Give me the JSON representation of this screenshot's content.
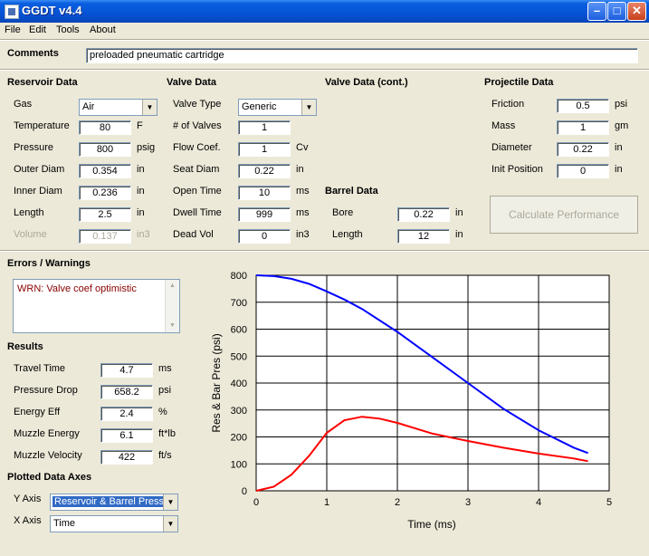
{
  "window": {
    "title": "GGDT v4.4"
  },
  "menu": [
    "File",
    "Edit",
    "Tools",
    "About"
  ],
  "comments": {
    "label": "Comments",
    "value": "preloaded pneumatic cartridge"
  },
  "reservoir": {
    "heading": "Reservoir Data",
    "gas_label": "Gas",
    "gas_value": "Air",
    "rows": [
      {
        "label": "Temperature",
        "value": "80",
        "unit": "F"
      },
      {
        "label": "Pressure",
        "value": "800",
        "unit": "psig"
      },
      {
        "label": "Outer Diam",
        "value": "0.354",
        "unit": "in"
      },
      {
        "label": "Inner Diam",
        "value": "0.236",
        "unit": "in"
      },
      {
        "label": "Length",
        "value": "2.5",
        "unit": "in"
      },
      {
        "label": "Volume",
        "value": "0.137",
        "unit": "in3"
      }
    ]
  },
  "valve": {
    "heading": "Valve Data",
    "type_label": "Valve Type",
    "type_value": "Generic",
    "rows": [
      {
        "label": "# of Valves",
        "value": "1",
        "unit": ""
      },
      {
        "label": "Flow Coef.",
        "value": "1",
        "unit": "Cv"
      },
      {
        "label": "Seat Diam",
        "value": "0.22",
        "unit": "in"
      },
      {
        "label": "Open Time",
        "value": "10",
        "unit": "ms"
      },
      {
        "label": "Dwell Time",
        "value": "999",
        "unit": "ms"
      },
      {
        "label": "Dead Vol",
        "value": "0",
        "unit": "in3"
      }
    ]
  },
  "valve_cont": {
    "heading": "Valve Data (cont.)"
  },
  "barrel": {
    "heading": "Barrel Data",
    "rows": [
      {
        "label": "Bore",
        "value": "0.22",
        "unit": "in"
      },
      {
        "label": "Length",
        "value": "12",
        "unit": "in"
      }
    ]
  },
  "projectile": {
    "heading": "Projectile Data",
    "rows": [
      {
        "label": "Friction",
        "value": "0.5",
        "unit": "psi"
      },
      {
        "label": "Mass",
        "value": "1",
        "unit": "gm"
      },
      {
        "label": "Diameter",
        "value": "0.22",
        "unit": "in"
      },
      {
        "label": "Init Position",
        "value": "0",
        "unit": "in"
      }
    ]
  },
  "calculate_label": "Calculate Performance",
  "errors": {
    "heading": "Errors / Warnings",
    "text": "WRN: Valve coef optimistic"
  },
  "results": {
    "heading": "Results",
    "rows": [
      {
        "label": "Travel Time",
        "value": "4.7",
        "unit": "ms"
      },
      {
        "label": "Pressure Drop",
        "value": "658.2",
        "unit": "psi"
      },
      {
        "label": "Energy Eff",
        "value": "2.4",
        "unit": "%"
      },
      {
        "label": "Muzzle Energy",
        "value": "6.1",
        "unit": "ft*lb"
      },
      {
        "label": "Muzzle Velocity",
        "value": "422",
        "unit": "ft/s"
      }
    ]
  },
  "axes": {
    "heading": "Plotted Data Axes",
    "y_label": "Y Axis",
    "y_value": "Reservoir & Barrel Pressure",
    "x_label": "X Axis",
    "x_value": "Time"
  },
  "colors": {
    "reservoir": "#0000ff",
    "barrel": "#ff0000"
  },
  "chart_data": {
    "type": "line",
    "title": "",
    "xlabel": "Time (ms)",
    "ylabel": "Res & Bar Pres (psi)",
    "xlim": [
      0,
      5
    ],
    "ylim": [
      0,
      800
    ],
    "xticks": [
      0,
      1,
      2,
      3,
      4,
      5
    ],
    "yticks": [
      0,
      100,
      200,
      300,
      400,
      500,
      600,
      700,
      800
    ],
    "grid": true,
    "series": [
      {
        "color": "#0000ff",
        "x": [
          0,
          0.25,
          0.5,
          0.75,
          1.0,
          1.25,
          1.5,
          2.0,
          2.5,
          3.0,
          3.5,
          4.0,
          4.5,
          4.7
        ],
        "y": [
          800,
          797,
          787,
          768,
          740,
          710,
          675,
          590,
          495,
          400,
          305,
          225,
          160,
          140
        ]
      },
      {
        "color": "#ff0000",
        "x": [
          0,
          0.25,
          0.5,
          0.75,
          1.0,
          1.25,
          1.5,
          1.75,
          2.0,
          2.5,
          3.0,
          3.5,
          4.0,
          4.5,
          4.7
        ],
        "y": [
          0,
          15,
          60,
          130,
          215,
          262,
          275,
          268,
          252,
          212,
          185,
          160,
          138,
          120,
          110
        ]
      }
    ]
  }
}
